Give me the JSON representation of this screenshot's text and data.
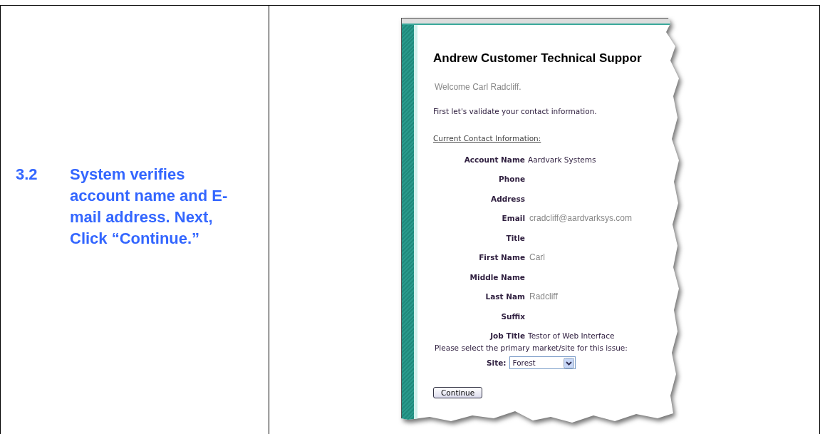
{
  "step": {
    "number": "3.2",
    "text": "System verifies account name and E-mail address. Next, Click “Continue.”"
  },
  "screenshot": {
    "title": "Andrew Customer Technical Suppor",
    "welcome": "Welcome Carl Radcliff.",
    "intro": "First let's validate your contact information.",
    "section_heading": "Current Contact Information:",
    "fields": [
      {
        "label": "Account Name",
        "value": "Aardvark Systems",
        "kind": "text"
      },
      {
        "label": "Phone"
      },
      {
        "label": "Address"
      },
      {
        "label": "Email",
        "value": "cradcliff@aardvarksys.com",
        "kind": "prefilled"
      },
      {
        "label": "Title"
      },
      {
        "label": "First Name",
        "value": "Carl",
        "kind": "prefilled"
      },
      {
        "label": "Middle Name"
      },
      {
        "label": "Last Nam",
        "value": "Radcliff",
        "kind": "prefilled"
      },
      {
        "label": "Suffix"
      },
      {
        "label": "Job Title",
        "value": "Testor of Web Interface",
        "kind": "text"
      }
    ],
    "site_prompt": "Please select the primary market/site for this issue:",
    "site_label": "Site:",
    "site_value": "Forest",
    "continue_button": "Continue"
  }
}
